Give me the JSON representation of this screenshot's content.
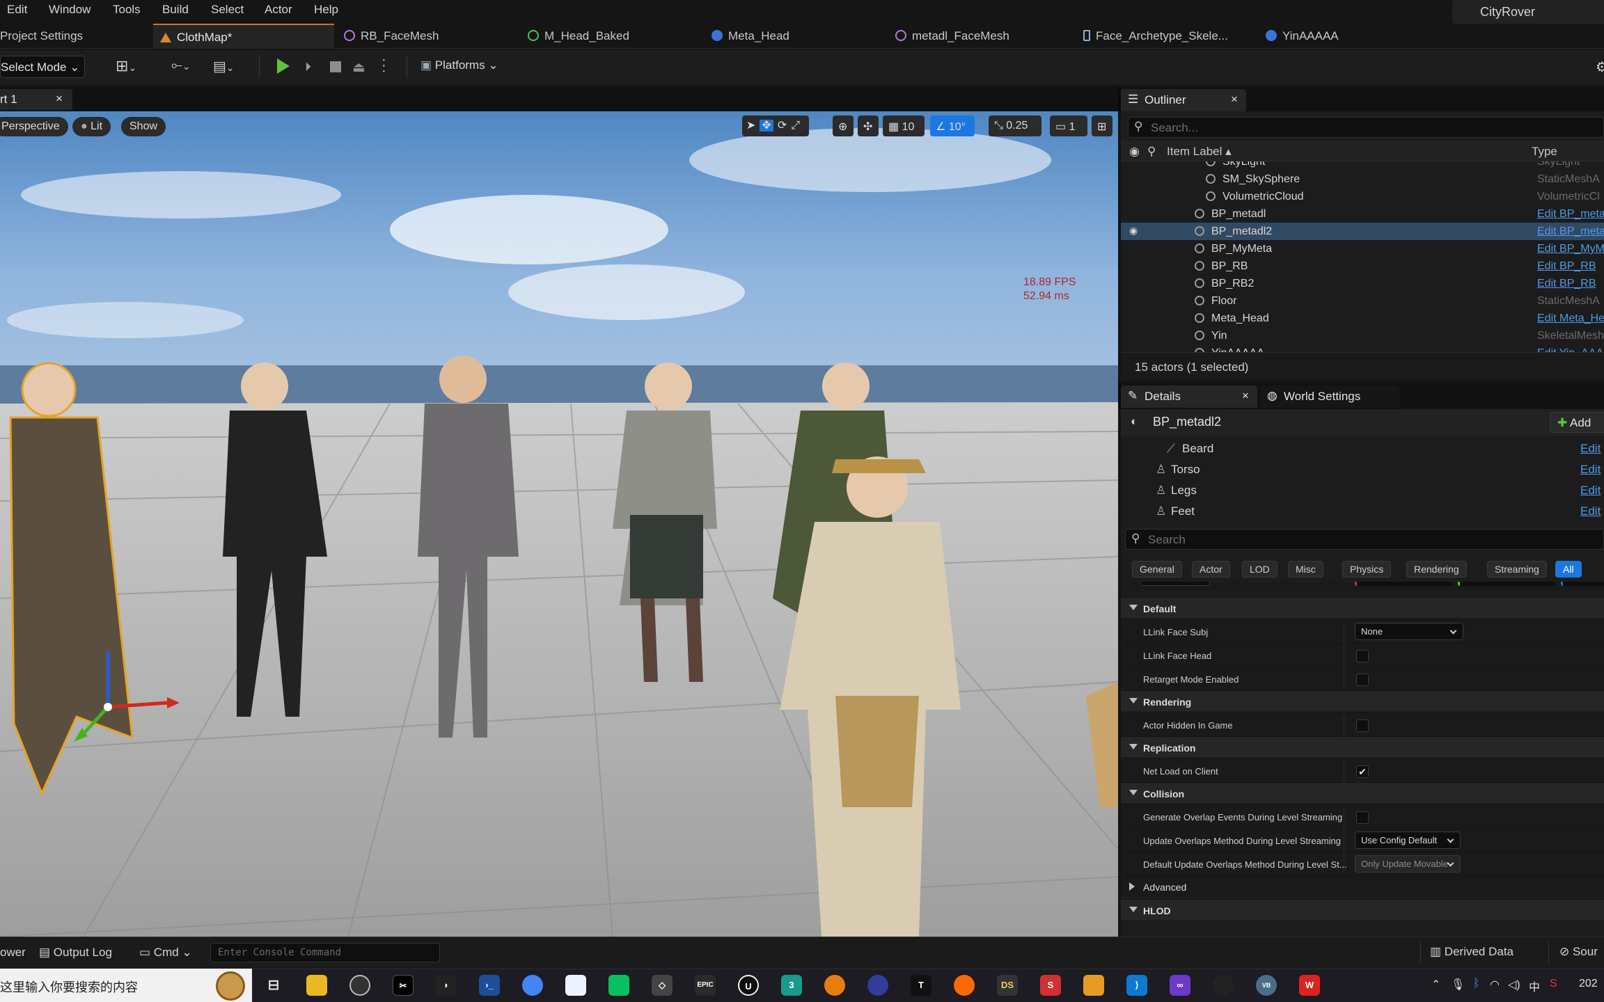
{
  "menu": {
    "items": [
      "Edit",
      "Window",
      "Tools",
      "Build",
      "Select",
      "Actor",
      "Help"
    ],
    "project_name": "CityRover"
  },
  "tabs": [
    {
      "label": "Project Settings"
    },
    {
      "label": "ClothMap*"
    },
    {
      "label": "RB_FaceMesh"
    },
    {
      "label": "M_Head_Baked"
    },
    {
      "label": "Meta_Head"
    },
    {
      "label": "metadl_FaceMesh"
    },
    {
      "label": "Face_Archetype_Skele..."
    },
    {
      "label": "YinAAAAA"
    }
  ],
  "toolbar": {
    "select_mode": "Select Mode",
    "platforms": "Platforms"
  },
  "viewport": {
    "tab_label": "rt 1",
    "close": "×",
    "perspective": "Perspective",
    "lit": "Lit",
    "show": "Show",
    "grid_snap": "10",
    "rotation_snap": "10°",
    "scale_snap": "0.25",
    "camera_speed": "1",
    "fps": "18.89 FPS",
    "ms": "52.94 ms"
  },
  "outliner": {
    "tab_label": "Outliner",
    "close": "×",
    "search_placeholder": "Search...",
    "col_label": "Item Label ▴",
    "col_type": "Type",
    "rows": [
      {
        "label": "SkyLight",
        "type": "SkyLight",
        "link": false,
        "indent": 2
      },
      {
        "label": "SM_SkySphere",
        "type": "StaticMeshA",
        "link": false,
        "indent": 2
      },
      {
        "label": "VolumetricCloud",
        "type": "VolumetricCl",
        "link": false,
        "indent": 2
      },
      {
        "label": "BP_metadl",
        "type": "Edit BP_meta",
        "link": true,
        "indent": 1
      },
      {
        "label": "BP_metadl2",
        "type": "Edit BP_meta",
        "link": true,
        "indent": 1,
        "selected": true
      },
      {
        "label": "BP_MyMeta",
        "type": "Edit BP_MyM",
        "link": true,
        "indent": 1
      },
      {
        "label": "BP_RB",
        "type": "Edit BP_RB",
        "link": true,
        "indent": 1
      },
      {
        "label": "BP_RB2",
        "type": "Edit BP_RB",
        "link": true,
        "indent": 1
      },
      {
        "label": "Floor",
        "type": "StaticMeshA",
        "link": false,
        "indent": 1
      },
      {
        "label": "Meta_Head",
        "type": "Edit Meta_He",
        "link": true,
        "indent": 1
      },
      {
        "label": "Yin",
        "type": "SkeletalMesh",
        "link": false,
        "indent": 1
      },
      {
        "label": "YinAAAAA",
        "type": "Edit Yin_AAA",
        "link": true,
        "indent": 1
      }
    ],
    "actor_count": "15 actors (1 selected)"
  },
  "details": {
    "tab_label": "Details",
    "world_settings": "World Settings",
    "close": "×",
    "actor_name": "BP_metadl2",
    "add_label": "Add",
    "components": [
      {
        "label": "Beard",
        "edit": "Edit"
      },
      {
        "label": "Torso",
        "edit": "Edit"
      },
      {
        "label": "Legs",
        "edit": "Edit"
      },
      {
        "label": "Feet",
        "edit": "Edit"
      }
    ],
    "search_placeholder": "Search",
    "filters": [
      "General",
      "Actor",
      "LOD",
      "Misc",
      "Physics",
      "Rendering",
      "Streaming",
      "All"
    ],
    "active_filter": "All",
    "sections": [
      {
        "name": "Default",
        "props": [
          {
            "name": "LLink Face Subj",
            "kind": "combo",
            "value": "None"
          },
          {
            "name": "LLink Face Head",
            "kind": "check",
            "checked": false
          },
          {
            "name": "Retarget Mode Enabled",
            "kind": "check",
            "checked": false
          }
        ]
      },
      {
        "name": "Rendering",
        "props": [
          {
            "name": "Actor Hidden In Game",
            "kind": "check",
            "checked": false
          }
        ]
      },
      {
        "name": "Replication",
        "props": [
          {
            "name": "Net Load on Client",
            "kind": "check",
            "checked": true
          }
        ]
      },
      {
        "name": "Collision",
        "props": [
          {
            "name": "Generate Overlap Events During Level Streaming",
            "kind": "check",
            "checked": false
          },
          {
            "name": "Update Overlaps Method During Level Streaming",
            "kind": "combo",
            "value": "Use Config Default"
          },
          {
            "name": "Default Update Overlaps Method During Level St...",
            "kind": "combo",
            "value": "Only Update Movable",
            "disabled": true
          },
          {
            "name": "Advanced",
            "kind": "expander"
          }
        ]
      },
      {
        "name": "HLOD",
        "props": []
      }
    ]
  },
  "bottom": {
    "browser": "ower",
    "output_log": "Output Log",
    "cmd": "Cmd",
    "console_placeholder": "Enter Console Command",
    "derived_data": "Derived Data",
    "source": "Sour"
  },
  "taskbar": {
    "search_text": "这里输入你要搜索的内容",
    "clock": "202",
    "ime": "中"
  },
  "colors": {
    "accent": "#1a78e0",
    "tab_accent": "#c07a2c",
    "selection": "#314a63",
    "link": "#4f9ae8",
    "fps_red": "#b3262b"
  }
}
